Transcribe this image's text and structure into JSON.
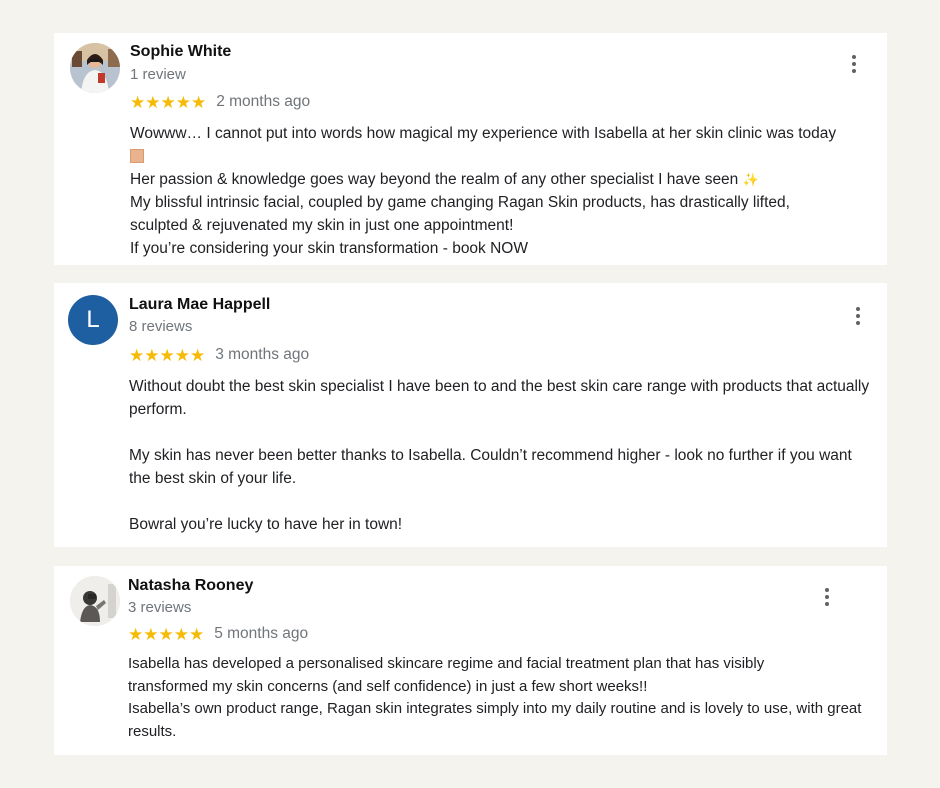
{
  "reviews": [
    {
      "name": "Sophie White",
      "count": "1 review",
      "stars": "★★★★★",
      "time": "2 months ago",
      "lines": [
        "Wowww… I cannot put into words how magical my experience with Isabella at her skin clinic was today",
        "Her passion & knowledge goes way beyond the realm of any other specialist I have seen",
        "My blissful intrinsic facial, coupled by game changing Ragan Skin products, has drastically lifted, sculpted & rejuvenated my skin in just one appointment!",
        "If you’re considering your skin transformation - book NOW"
      ],
      "emoji_1": "emoji-square",
      "emoji_2": "✨"
    },
    {
      "name": "Laura Mae Happell",
      "initial": "L",
      "count": "8 reviews",
      "stars": "★★★★★",
      "time": "3 months ago",
      "paragraphs": [
        "Without doubt the best skin specialist I have been to and the best skin care range with products that actually perform.",
        "My skin has never been better thanks to Isabella. Couldn’t recommend higher - look no further if you want the best skin of your life.",
        "Bowral you’re lucky to have her in town!"
      ]
    },
    {
      "name": "Natasha Rooney",
      "count": "3 reviews",
      "stars": "★★★★★",
      "time": "5 months ago",
      "lines": [
        "Isabella has developed a personalised skincare regime and facial treatment plan that has visibly transformed my skin concerns (and self confidence) in just a few short weeks!!",
        "Isabella’s own product range, Ragan skin integrates simply into my daily routine and is lovely to use, with great results."
      ]
    }
  ],
  "colors": {
    "background": "#f4f3ee",
    "card": "#ffffff",
    "star": "#f6bb06",
    "secondary_text": "#70757a",
    "avatar_blue": "#1d5fa0"
  },
  "icons": {
    "menu": "more-vert-icon",
    "star": "star-icon"
  }
}
